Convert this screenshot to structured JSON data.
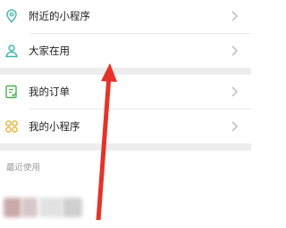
{
  "menu_group_1": [
    {
      "label": "附近的小程序",
      "icon": "location-pin-icon"
    },
    {
      "label": "大家在用",
      "icon": "people-icon"
    }
  ],
  "menu_group_2": [
    {
      "label": "我的订单",
      "icon": "order-list-icon"
    },
    {
      "label": "我的小程序",
      "icon": "mini-program-icon"
    }
  ],
  "recent": {
    "title": "最近使用"
  },
  "colors": {
    "accent_teal": "#3fb5a8",
    "accent_green": "#4caf50",
    "accent_yellow": "#e6b43a",
    "arrow_red": "#e5332a",
    "separator": "#ededed"
  }
}
